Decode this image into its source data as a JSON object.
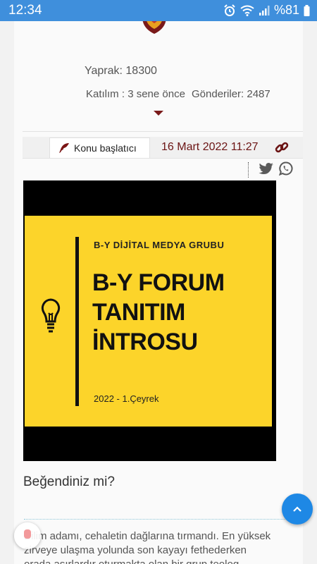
{
  "status_bar": {
    "time": "12:34",
    "battery": "%81",
    "icons": [
      "alarm-icon",
      "wifi-icon",
      "signal-icon",
      "battery-icon"
    ]
  },
  "user": {
    "pages_label": "Yaprak:",
    "pages_value": "18300",
    "joined_label": "Katılım :",
    "joined_value": "3 sene önce",
    "posts_label": "Gönderiler:",
    "posts_value": "2487"
  },
  "post": {
    "starter_label": "Konu başlatıcı",
    "date": "16 Mart 2022 11:27",
    "share_icons": [
      "twitter-icon",
      "whatsapp-icon"
    ]
  },
  "intro_image": {
    "subtitle": "B-Y DİJİTAL MEDYA GRUBU",
    "title_line1": "B-Y FORUM",
    "title_line2": "TANITIM",
    "title_line3": "İNTROSU",
    "footer": "2022 - 1.Çeyrek"
  },
  "like_prompt": "Beğendiniz mi?",
  "body_text": "Bilim adamı, cehaletin dağlarına tırmandı. En yüksek zirveye ulaşma yolunda son kayayı fethederken orada asırlardır oturmakta olan bir grup teolog tarafından",
  "colors": {
    "status_bar": "#3f8fdc",
    "accent_dark_red": "#6b1414",
    "image_yellow": "#fcd42a",
    "fab_blue": "#1e88e5"
  }
}
